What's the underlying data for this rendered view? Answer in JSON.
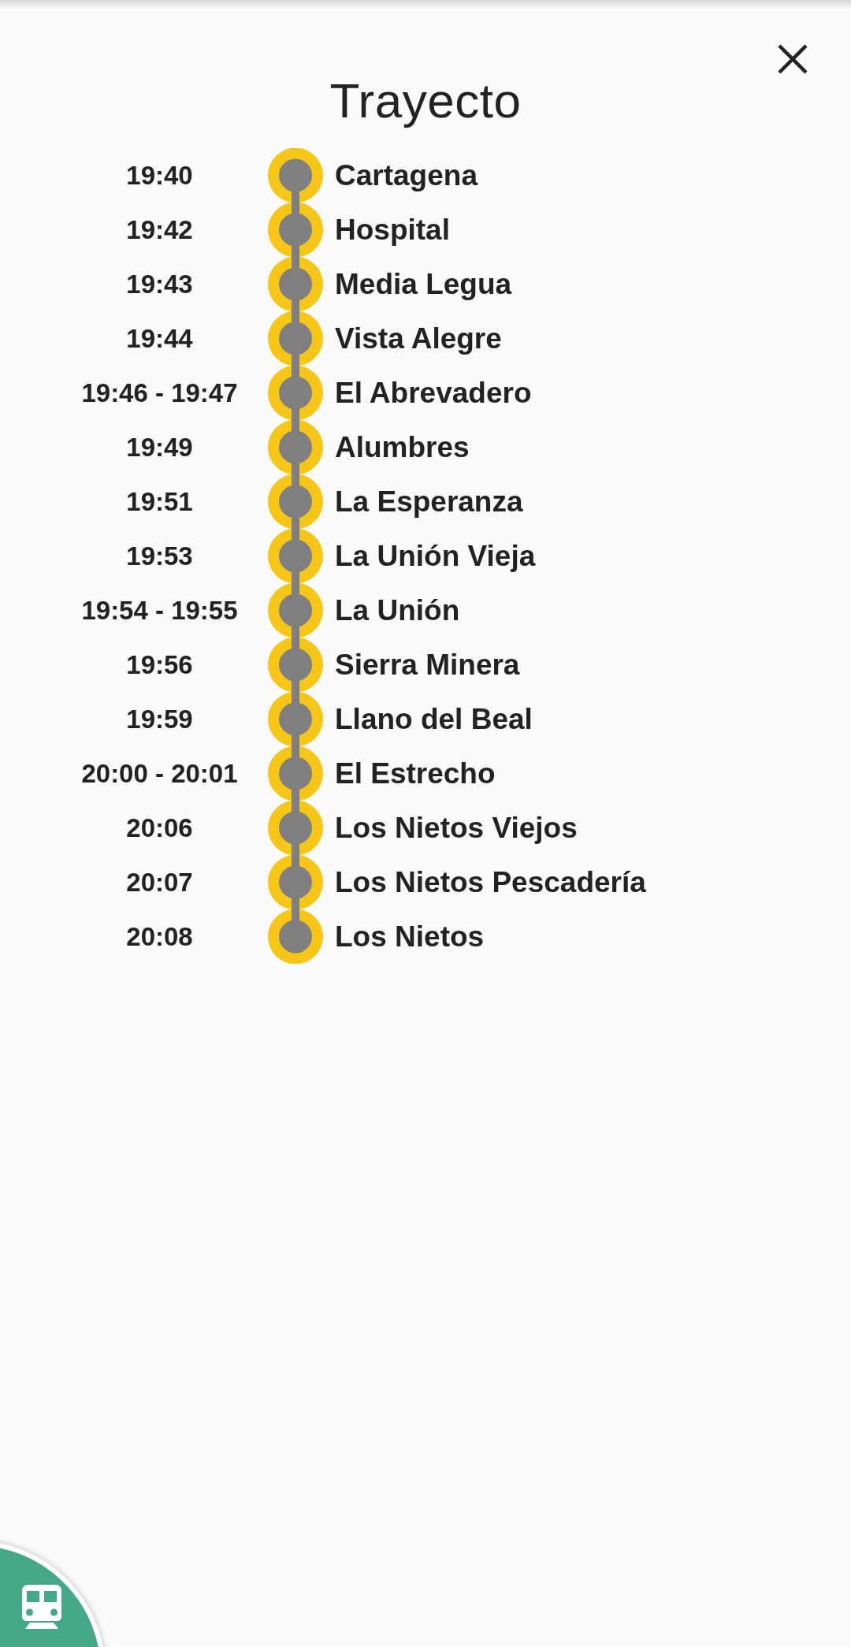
{
  "title": "Trayecto",
  "stops": [
    {
      "time": "19:40",
      "station": "Cartagena"
    },
    {
      "time": "19:42",
      "station": "Hospital"
    },
    {
      "time": "19:43",
      "station": "Media Legua"
    },
    {
      "time": "19:44",
      "station": "Vista Alegre"
    },
    {
      "time": "19:46 - 19:47",
      "station": "El Abrevadero"
    },
    {
      "time": "19:49",
      "station": "Alumbres"
    },
    {
      "time": "19:51",
      "station": "La Esperanza"
    },
    {
      "time": "19:53",
      "station": "La Unión Vieja"
    },
    {
      "time": "19:54 - 19:55",
      "station": "La Unión"
    },
    {
      "time": "19:56",
      "station": "Sierra Minera"
    },
    {
      "time": "19:59",
      "station": "Llano del Beal"
    },
    {
      "time": "20:00 - 20:01",
      "station": "El Estrecho"
    },
    {
      "time": "20:06",
      "station": "Los Nietos Viejos"
    },
    {
      "time": "20:07",
      "station": "Los Nietos Pescadería"
    },
    {
      "time": "20:08",
      "station": "Los Nietos"
    }
  ]
}
